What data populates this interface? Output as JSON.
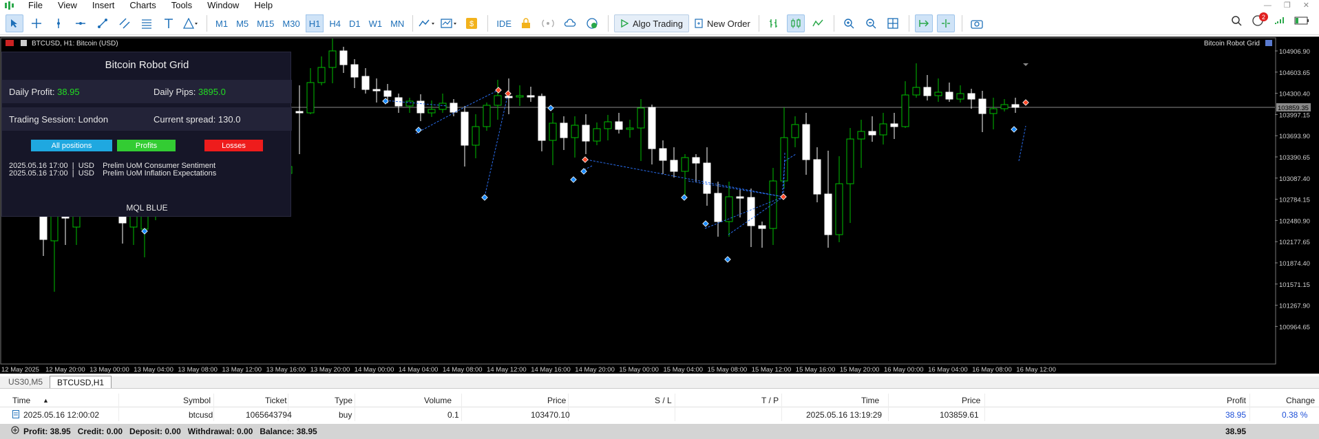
{
  "menu": [
    "File",
    "View",
    "Insert",
    "Charts",
    "Tools",
    "Window",
    "Help"
  ],
  "timeframes": [
    "M1",
    "M5",
    "M15",
    "M30",
    "H1",
    "H4",
    "D1",
    "W1",
    "MN"
  ],
  "active_timeframe": "H1",
  "toolbar": {
    "ide": "IDE",
    "algo": "Algo Trading",
    "new_order": "New Order"
  },
  "notifications": "2",
  "chart": {
    "title": "BTCUSD, H1:  Bitcoin (USD)",
    "ea_name": "Bitcoin Robot Grid",
    "current_price": "103859.35",
    "price_labels": [
      "104906.90",
      "104603.65",
      "104300.40",
      "103997.15",
      "103693.90",
      "103390.65",
      "103087.40",
      "102784.15",
      "102480.90",
      "102177.65",
      "101874.40",
      "101571.15",
      "101267.90",
      "100964.65"
    ],
    "time_labels": [
      "12 May 2025",
      "12 May 20:00",
      "13 May 00:00",
      "13 May 04:00",
      "13 May 08:00",
      "13 May 12:00",
      "13 May 16:00",
      "13 May 20:00",
      "14 May 00:00",
      "14 May 04:00",
      "14 May 08:00",
      "14 May 12:00",
      "14 May 16:00",
      "14 May 20:00",
      "15 May 00:00",
      "15 May 04:00",
      "15 May 08:00",
      "15 May 12:00",
      "15 May 16:00",
      "15 May 20:00",
      "16 May 00:00",
      "16 May 04:00",
      "16 May 08:00",
      "16 May 12:00"
    ]
  },
  "panel": {
    "title": "Bitcoin Robot Grid",
    "daily_profit_label": "Daily Profit:",
    "daily_profit": "38.95",
    "daily_pips_label": "Daily Pips:",
    "daily_pips": "3895.0",
    "session": "Trading Session: London",
    "spread": "Current spread: 130.0",
    "btn_all": "All positions",
    "btn_profits": "Profits",
    "btn_losses": "Losses",
    "news": [
      "2025.05.16 17:00  |  USD    Prelim UoM Consumer Sentiment",
      "2025.05.16 17:00  |  USD    Prelim UoM Inflation Expectations"
    ],
    "footer": "MQL BLUE"
  },
  "tabs": [
    "US30,M5",
    "BTCUSD,H1"
  ],
  "active_tab": "BTCUSD,H1",
  "table": {
    "headers": {
      "time": "Time",
      "symbol": "Symbol",
      "ticket": "Ticket",
      "type": "Type",
      "volume": "Volume",
      "price": "Price",
      "sl": "S / L",
      "tp": "T / P",
      "time2": "Time",
      "price2": "Price",
      "profit": "Profit",
      "change": "Change"
    },
    "row": {
      "time": "2025.05.16 12:00:02",
      "symbol": "btcusd",
      "ticket": "1065643794",
      "type": "buy",
      "volume": "0.1",
      "price": "103470.10",
      "time2": "2025.05.16 13:19:29",
      "price2": "103859.61",
      "profit": "38.95",
      "change": "0.38 %"
    },
    "footer": {
      "summary": "Profit: 38.95   Credit: 0.00   Deposit: 0.00   Withdrawal: 0.00   Balance: 38.95",
      "total": "38.95"
    }
  },
  "colors": {
    "bull": "#00c000",
    "bear": "#ffffff",
    "profit": "#22dd22",
    "btn_all": "#1fa8e0",
    "btn_profits": "#33cc33",
    "btn_losses": "#ee1c1c"
  }
}
